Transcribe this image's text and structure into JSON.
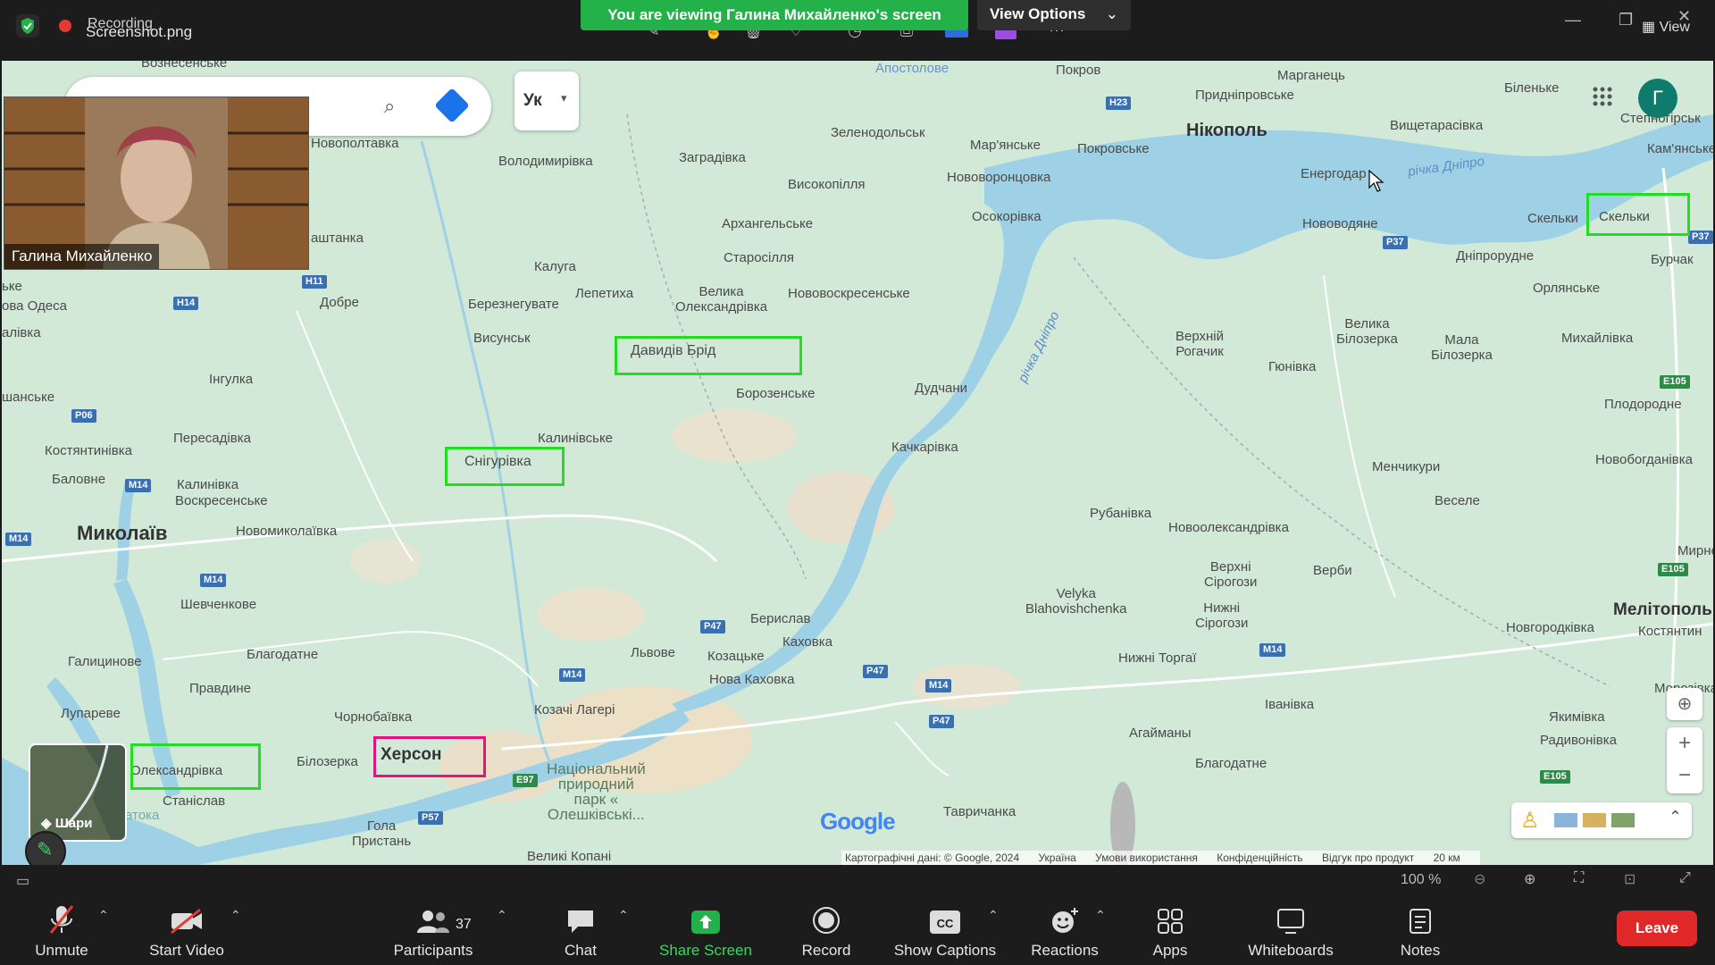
{
  "top": {
    "recording_label": "Recording",
    "file_label": "Screenshot.png",
    "viewing_banner": "You are viewing Галина Михайленко's screen",
    "view_options": "View Options",
    "view_button": "View"
  },
  "video": {
    "participant_name": "Галина Михайленко"
  },
  "map": {
    "language_button": "Ук",
    "avatar_letter": "Г",
    "layers_label": "Шари",
    "google_logo": "Google",
    "attribution": {
      "data": "Картографічні дані: © Google, 2024",
      "country": "Україна",
      "terms": "Умови використання",
      "privacy": "Конфіденційність",
      "feedback": "Відгук про продукт",
      "scale": "20 км"
    },
    "places": [
      {
        "id": "voskresenske",
        "text": "Вознесенське"
      },
      {
        "id": "apostolove",
        "text": "Апостолове"
      },
      {
        "id": "pokrov",
        "text": "Покров"
      },
      {
        "id": "marhanets",
        "text": "Марганець"
      },
      {
        "id": "bilenke",
        "text": "Біленьке"
      },
      {
        "id": "pryd",
        "text": "Придніпровське"
      },
      {
        "id": "nikopol",
        "text": "Нікополь"
      },
      {
        "id": "stepnohirsk",
        "text": "Степногірськ"
      },
      {
        "id": "zelenodolsk",
        "text": "Зеленодольськ"
      },
      {
        "id": "marianske",
        "text": "Мар'янське"
      },
      {
        "id": "pokrovske",
        "text": "Покровське"
      },
      {
        "id": "vyshchetarasivka",
        "text": "Вищетарасівка"
      },
      {
        "id": "kamianske",
        "text": "Кам'янське"
      },
      {
        "id": "novopoltavka",
        "text": "Новополтавка"
      },
      {
        "id": "volodymyrivka",
        "text": "Володимирівка"
      },
      {
        "id": "zahradivka",
        "text": "Заградівка"
      },
      {
        "id": "novovorontsovka",
        "text": "Нововоронцовка"
      },
      {
        "id": "enerhodar",
        "text": "Енергодар"
      },
      {
        "id": "richka_dnipro_top",
        "text": "річка Дніпро"
      },
      {
        "id": "vysokopillia",
        "text": "Високопілля"
      },
      {
        "id": "osokorivka",
        "text": "Осокорівка"
      },
      {
        "id": "novovodiane",
        "text": "Нововодяне"
      },
      {
        "id": "skelky",
        "text": "Скельки"
      },
      {
        "id": "arkhanhelske",
        "text": "Архангельське"
      },
      {
        "id": "dniprorudne",
        "text": "Дніпрорудне"
      },
      {
        "id": "burchak",
        "text": "Бурчак"
      },
      {
        "id": "tashtanka",
        "text": "аштанка"
      },
      {
        "id": "starosillia",
        "text": "Старосілля"
      },
      {
        "id": "kaluha",
        "text": "Калуга"
      },
      {
        "id": "dobre",
        "text": "Добре"
      },
      {
        "id": "yke",
        "text": "ьке"
      },
      {
        "id": "lepetykha",
        "text": "Лепетиха"
      },
      {
        "id": "velyka_oleksandrivka",
        "text": "Велика\nОлександрівка"
      },
      {
        "id": "novovoskresenske",
        "text": "Нововоскресенське"
      },
      {
        "id": "orlianske",
        "text": "Орлянське"
      },
      {
        "id": "berezneguvate",
        "text": "Березнегувате"
      },
      {
        "id": "richka_dnipro_mid",
        "text": "річка Дніпро"
      },
      {
        "id": "nova_odesa",
        "text": "ова Одеса"
      },
      {
        "id": "velyka_bilozerka",
        "text": "Велика\nБілозерка"
      },
      {
        "id": "mala_bilozerka",
        "text": "Мала\nБілозерка"
      },
      {
        "id": "mykhailivka",
        "text": "Михайлівка"
      },
      {
        "id": "verkhnii_rohachyk",
        "text": "Верхній\nРогачик"
      },
      {
        "id": "alivka",
        "text": "алівка"
      },
      {
        "id": "vysunsk",
        "text": "Висунськ"
      },
      {
        "id": "davydiv_brid",
        "text": "Давидів Брід"
      },
      {
        "id": "hunivka",
        "text": "Гюнівка"
      },
      {
        "id": "inhulka",
        "text": "Інгулка"
      },
      {
        "id": "dudchany",
        "text": "Дудчани"
      },
      {
        "id": "boroznenske",
        "text": "Борозенське"
      },
      {
        "id": "shanske",
        "text": "шанське"
      },
      {
        "id": "plodorodne",
        "text": "Плодородне"
      },
      {
        "id": "peresadivka",
        "text": "Пересадівка"
      },
      {
        "id": "kalyninske",
        "text": "Калинівське"
      },
      {
        "id": "kachkarivka",
        "text": "Качкарівка"
      },
      {
        "id": "kostiantynivka",
        "text": "Костянтинівка"
      },
      {
        "id": "snihurivka",
        "text": "Снігурівка"
      },
      {
        "id": "menchykury",
        "text": "Менчикури"
      },
      {
        "id": "novobohdanivka",
        "text": "Новобогданівка"
      },
      {
        "id": "kalynivka",
        "text": "Калинівка"
      },
      {
        "id": "bashtanka2",
        "text": "Баловне"
      },
      {
        "id": "voskresenske2",
        "text": "Воскресенське"
      },
      {
        "id": "vesele",
        "text": "Веселе"
      },
      {
        "id": "mykolaiv",
        "text": "Миколаїв"
      },
      {
        "id": "novomykolaivka",
        "text": "Новомиколаївка"
      },
      {
        "id": "rubanivka",
        "text": "Рубанівка"
      },
      {
        "id": "novooleksandrivka",
        "text": "Новоолександрівка"
      },
      {
        "id": "verkhni_sirohozy",
        "text": "Верхні\nСірогози"
      },
      {
        "id": "verby",
        "text": "Верби"
      },
      {
        "id": "myrne",
        "text": "Мирне"
      },
      {
        "id": "shevchenkove",
        "text": "Шевченкове"
      },
      {
        "id": "velyka_blahovishchenka",
        "text": "Velyka\nBlahovishchenka"
      },
      {
        "id": "nyzhni_sirohozy",
        "text": "Нижні\nСірогози"
      },
      {
        "id": "melitopol",
        "text": "Мелітополь"
      },
      {
        "id": "kostiantynivka2",
        "text": "Костянтин"
      },
      {
        "id": "beryslav",
        "text": "Берислав"
      },
      {
        "id": "kakhovka",
        "text": "Каховка"
      },
      {
        "id": "novhorodkivka",
        "text": "Новгородківка"
      },
      {
        "id": "halytsynove",
        "text": "Галицинове"
      },
      {
        "id": "lvove",
        "text": "Львове"
      },
      {
        "id": "kozatske",
        "text": "Козацьке"
      },
      {
        "id": "blahodatne",
        "text": "Благодатне"
      },
      {
        "id": "nyzhni_torhai",
        "text": "Нижні Торгаї"
      },
      {
        "id": "nova_kakhovka",
        "text": "Нова Каховка"
      },
      {
        "id": "pravdyne",
        "text": "Правдине"
      },
      {
        "id": "morozivka",
        "text": "Морозівка"
      },
      {
        "id": "kozachi_laheri",
        "text": "Козачі Лагері"
      },
      {
        "id": "ivanivka",
        "text": "Іванівка"
      },
      {
        "id": "lupareve",
        "text": "Лупареве"
      },
      {
        "id": "chornobaivka",
        "text": "Чорнобаївка"
      },
      {
        "id": "yakymivka",
        "text": "Якимівка"
      },
      {
        "id": "ahaimany",
        "text": "Агайманы"
      },
      {
        "id": "radyvonivka",
        "text": "Радивонівка"
      },
      {
        "id": "oleksandrivka",
        "text": "Олександрівка"
      },
      {
        "id": "bilozerka",
        "text": "Білозерка"
      },
      {
        "id": "kherson",
        "text": "Херсон"
      },
      {
        "id": "natsionalnyi_park",
        "text": "Національний\nприродний\nпарк «\nОлешківські..."
      },
      {
        "id": "blahodatne2",
        "text": "Благодатне"
      },
      {
        "id": "stanislav",
        "text": "Станіслав"
      },
      {
        "id": "tavrychanka",
        "text": "Тавричанка"
      },
      {
        "id": "hola_prystan",
        "text": "Гола\nПристань"
      },
      {
        "id": "velyki_kopani",
        "text": "Великі Копані"
      },
      {
        "id": "atoka",
        "text": "атока"
      }
    ],
    "roads": [
      {
        "id": "h23",
        "text": "H23"
      },
      {
        "id": "h11",
        "text": "H11"
      },
      {
        "id": "h14",
        "text": "H14"
      },
      {
        "id": "p37",
        "text": "P37"
      },
      {
        "id": "p37b",
        "text": "P37"
      },
      {
        "id": "p06",
        "text": "P06"
      },
      {
        "id": "m14a",
        "text": "M14"
      },
      {
        "id": "m14b",
        "text": "M14"
      },
      {
        "id": "m14c",
        "text": "M14"
      },
      {
        "id": "m14d",
        "text": "M14"
      },
      {
        "id": "m14e",
        "text": "M14"
      },
      {
        "id": "m14f",
        "text": "M14"
      },
      {
        "id": "p47a",
        "text": "P47"
      },
      {
        "id": "p47b",
        "text": "P47"
      },
      {
        "id": "p47c",
        "text": "P47"
      },
      {
        "id": "e105a",
        "text": "E105"
      },
      {
        "id": "e105b",
        "text": "E105"
      },
      {
        "id": "e105c",
        "text": "E105"
      },
      {
        "id": "e97",
        "text": "E97"
      },
      {
        "id": "p57",
        "text": "P57"
      }
    ]
  },
  "midbar": {
    "zoom": "100 %"
  },
  "toolbar": {
    "unmute": "Unmute",
    "start_video": "Start Video",
    "participants": "Participants",
    "participants_count": "37",
    "chat": "Chat",
    "share_screen": "Share Screen",
    "record": "Record",
    "show_captions": "Show Captions",
    "reactions": "Reactions",
    "apps": "Apps",
    "whiteboards": "Whiteboards",
    "notes": "Notes",
    "leave": "Leave"
  }
}
